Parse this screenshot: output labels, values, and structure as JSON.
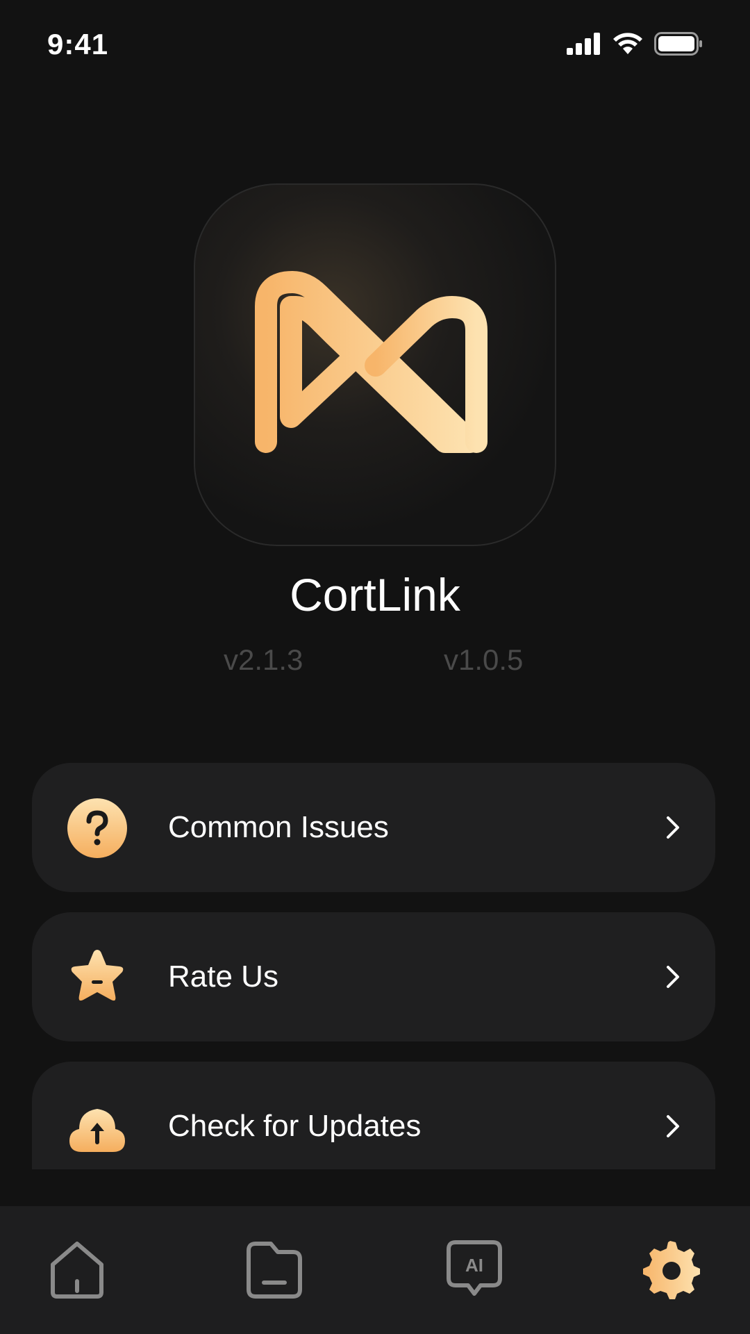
{
  "status_bar": {
    "time": "9:41"
  },
  "app": {
    "name": "CortLink",
    "version_left": "v2.1.3",
    "version_right": "v1.0.5"
  },
  "menu": [
    {
      "label": "Common Issues",
      "icon": "question-icon"
    },
    {
      "label": "Rate Us",
      "icon": "star-icon"
    },
    {
      "label": "Check for Updates",
      "icon": "cloud-upload-icon"
    }
  ],
  "tabs": [
    {
      "name": "home",
      "icon": "home-icon",
      "active": false
    },
    {
      "name": "files",
      "icon": "folder-icon",
      "active": false
    },
    {
      "name": "ai",
      "icon": "ai-chat-icon",
      "active": false
    },
    {
      "name": "settings",
      "icon": "gear-icon",
      "active": true
    }
  ],
  "colors": {
    "accent_start": "#f7b56a",
    "accent_end": "#fde2b0",
    "inactive_tab": "#8a8a8a",
    "card_bg": "#1f1f20",
    "background": "#121212"
  }
}
